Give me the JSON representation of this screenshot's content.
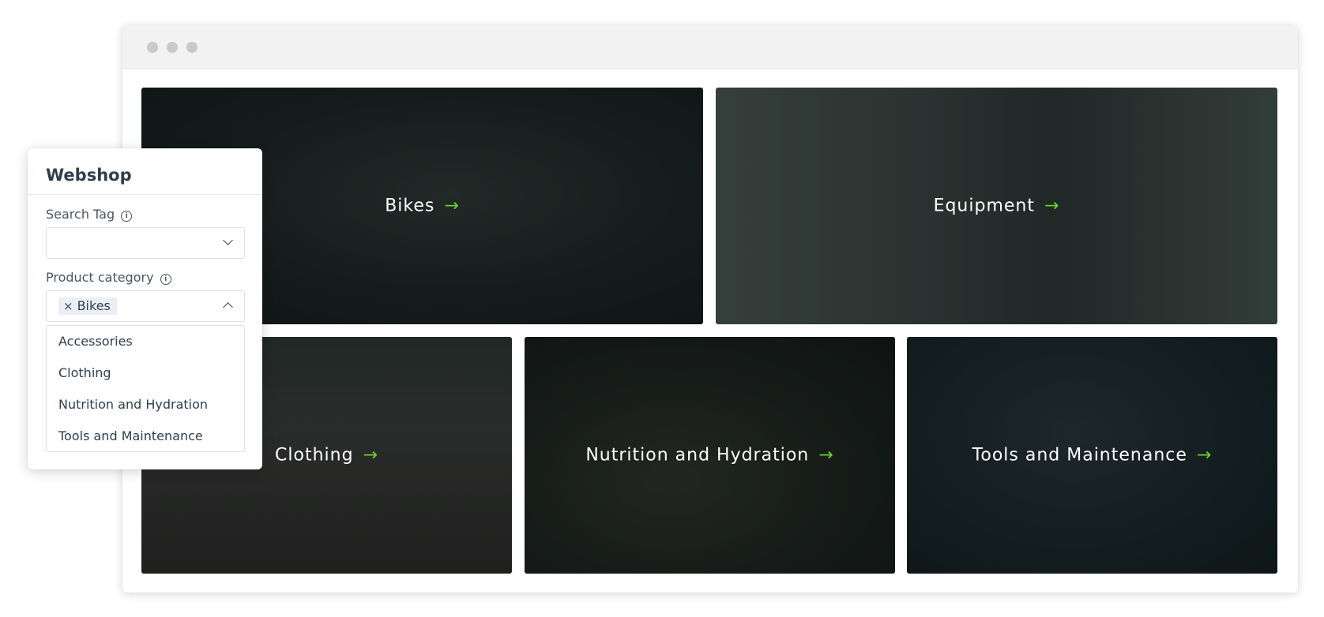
{
  "tiles": [
    {
      "label": "Bikes"
    },
    {
      "label": "Equipment"
    },
    {
      "label": "Clothing"
    },
    {
      "label": "Nutrition and Hydration"
    },
    {
      "label": "Tools and Maintenance"
    }
  ],
  "arrow": "→",
  "accent_color": "#6cd02a",
  "panel": {
    "title": "Webshop",
    "search_tag": {
      "label": "Search Tag",
      "value": ""
    },
    "product_category": {
      "label": "Product category",
      "selected": [
        "Bikes"
      ],
      "chip_remove": "×",
      "options": [
        "Accessories",
        "Clothing",
        "Nutrition and Hydration",
        "Tools and Maintenance"
      ]
    },
    "info_glyph": "i"
  }
}
